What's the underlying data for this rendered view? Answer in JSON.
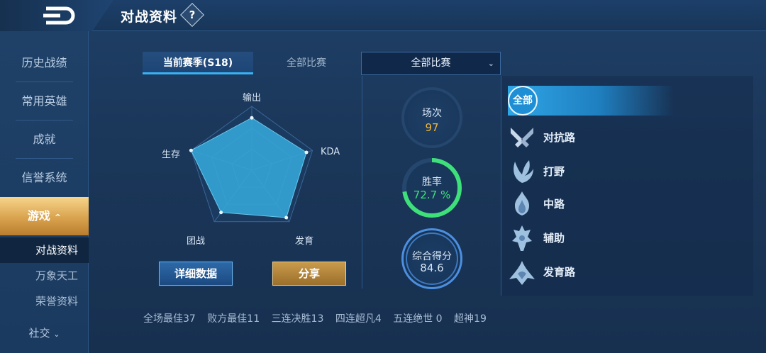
{
  "header": {
    "title": "对战资料",
    "help_glyph": "?"
  },
  "sidebar": {
    "items": [
      {
        "label": "历史战绩"
      },
      {
        "label": "常用英雄"
      },
      {
        "label": "成就"
      },
      {
        "label": "信誉系统"
      },
      {
        "label": "游戏",
        "chevron": "^",
        "active": true
      }
    ],
    "subitems": [
      {
        "label": "对战资料",
        "active": true
      },
      {
        "label": "万象天工"
      },
      {
        "label": "荣誉资料"
      }
    ],
    "social": {
      "label": "社交",
      "chevron": "⌄"
    }
  },
  "tabs": {
    "current_season": "当前赛季(S18)",
    "all_matches": "全部比赛"
  },
  "filter": {
    "selected": "全部比赛",
    "arrow": "⌄"
  },
  "radar": {
    "axes": [
      {
        "label": "输出",
        "value": 0.82
      },
      {
        "label": "KDA",
        "value": 0.9
      },
      {
        "label": "发育",
        "value": 0.92
      },
      {
        "label": "团战",
        "value": 0.82
      },
      {
        "label": "生存",
        "value": 1.0
      }
    ]
  },
  "buttons": {
    "detail": "详细数据",
    "share": "分享"
  },
  "summary": {
    "matches": {
      "label": "场次",
      "value": "97"
    },
    "win_rate": {
      "label": "胜率",
      "value": "72.7 %",
      "fraction": 0.727
    },
    "score": {
      "label": "综合得分",
      "value": "84.6"
    }
  },
  "roles": {
    "all_label": "全部",
    "items": [
      {
        "label": "对抗路",
        "icon": "crossed-swords-icon"
      },
      {
        "label": "打野",
        "icon": "claw-leaf-icon"
      },
      {
        "label": "中路",
        "icon": "flame-icon"
      },
      {
        "label": "辅助",
        "icon": "guardian-icon"
      },
      {
        "label": "发育路",
        "icon": "marksman-icon"
      }
    ]
  },
  "stats": [
    "全场最佳37",
    "败方最佳11",
    "三连决胜13",
    "四连超凡4",
    "五连绝世 0",
    "超神19"
  ],
  "colors": {
    "accent": "#38b2f2",
    "gold": "#e7b251",
    "win": "#3ee07a",
    "matches_value": "#f2b63c"
  }
}
